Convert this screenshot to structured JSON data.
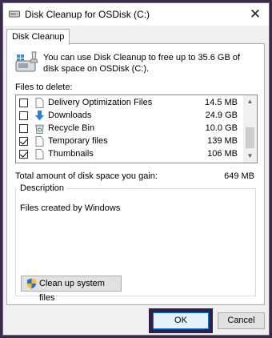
{
  "window": {
    "title": "Disk Cleanup for OSDisk (C:)"
  },
  "tabs": [
    {
      "label": "Disk Cleanup"
    }
  ],
  "intro": {
    "text": "You can use Disk Cleanup to free up to 35.6 GB of disk space on OSDisk (C:)."
  },
  "files_label": "Files to delete:",
  "files": [
    {
      "name": "Delivery Optimization Files",
      "size": "14.5 MB",
      "checked": false,
      "icon": "file-icon"
    },
    {
      "name": "Downloads",
      "size": "24.9 GB",
      "checked": false,
      "icon": "download-arrow-icon"
    },
    {
      "name": "Recycle Bin",
      "size": "10.0 GB",
      "checked": false,
      "icon": "recycle-bin-icon"
    },
    {
      "name": "Temporary files",
      "size": "139 MB",
      "checked": true,
      "icon": "file-icon"
    },
    {
      "name": "Thumbnails",
      "size": "106 MB",
      "checked": true,
      "icon": "file-icon"
    }
  ],
  "total": {
    "label": "Total amount of disk space you gain:",
    "value": "649 MB"
  },
  "description": {
    "legend": "Description",
    "text": "Files created by Windows"
  },
  "buttons": {
    "cleanup_system": "Clean up system files",
    "ok": "OK",
    "cancel": "Cancel"
  },
  "colors": {
    "ok_highlight": "#2e1f4d",
    "window_bg": "#f0f0f0"
  }
}
